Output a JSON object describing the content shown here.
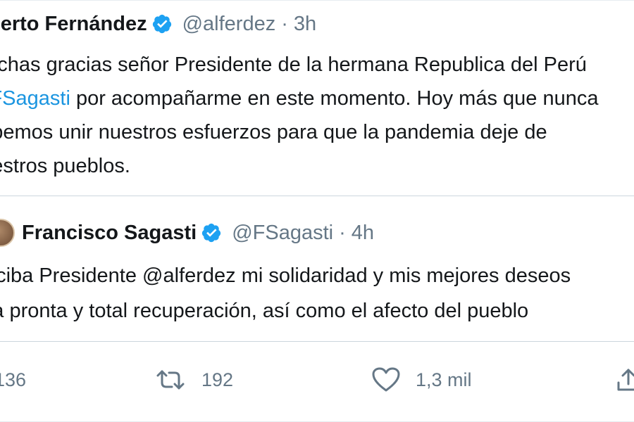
{
  "tweet": {
    "author_name": "Alberto Fernández",
    "handle": "@alferdez",
    "separator": "·",
    "time": "3h",
    "body_lines": [
      "Muchas gracias señor Presidente de la hermana Republica del Perú",
      " por acompañarme en este momento. Hoy más que nunca",
      "debemos unir nuestros esfuerzos para que la pandemia deje de",
      "nuestros pueblos."
    ],
    "mention": "@FSagasti"
  },
  "quoted_tweet": {
    "author_name": "Francisco Sagasti",
    "handle": "@FSagasti",
    "separator": "·",
    "time": "4h",
    "body_lines": [
      "Reciba Presidente @alferdez mi solidaridad y mis mejores deseos",
      "una pronta y total recuperación, así como el afecto del pueblo"
    ]
  },
  "actions": {
    "replies": "136",
    "retweets": "192",
    "likes": "1,3 mil"
  },
  "colors": {
    "text": "#14171a",
    "muted": "#657786",
    "link": "#1b95e0",
    "verified": "#1da1f2",
    "border": "#ccd6dd"
  },
  "icons": {
    "verified": "verified-badge-icon",
    "reply": "reply-icon",
    "retweet": "retweet-icon",
    "like": "heart-icon",
    "share": "share-icon"
  }
}
